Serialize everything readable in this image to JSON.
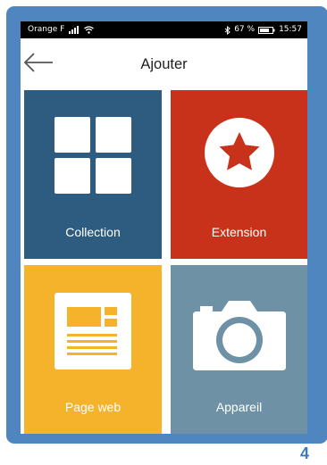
{
  "statusbar": {
    "carrier": "Orange F",
    "battery_percent": "67 %",
    "time": "15:57"
  },
  "header": {
    "title": "Ajouter",
    "back_icon": "back-arrow-icon"
  },
  "tiles": [
    {
      "label": "Collection",
      "icon": "grid-icon",
      "color": "#2e5b80"
    },
    {
      "label": "Extension",
      "icon": "star-icon",
      "color": "#c8321a"
    },
    {
      "label": "Page web",
      "icon": "webpage-icon",
      "color": "#f5b32c"
    },
    {
      "label": "Appareil",
      "icon": "camera-icon",
      "color": "#6f91a6"
    }
  ],
  "page_number": "4",
  "colors": {
    "frame": "#4f86bf",
    "statusbar": "#000000",
    "page_number": "#3f7ab8"
  }
}
